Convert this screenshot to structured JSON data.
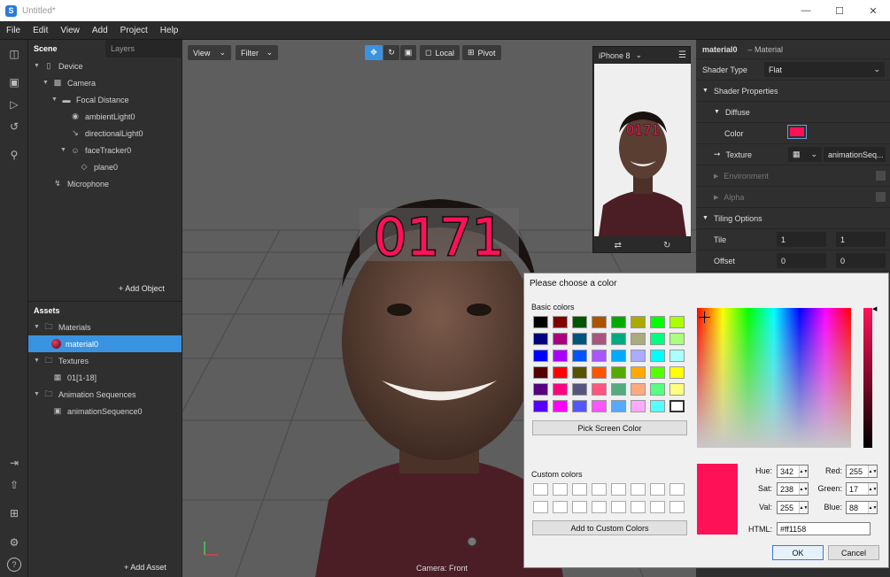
{
  "window": {
    "title": "Untitled*",
    "logo": "S"
  },
  "menu": [
    "File",
    "Edit",
    "View",
    "Add",
    "Project",
    "Help"
  ],
  "left_tools": [
    "layout-icon",
    "video-icon",
    "play-icon",
    "sync-icon",
    "search-icon",
    "import-icon",
    "share-icon",
    "folder-add-icon",
    "bug-icon",
    "help-icon"
  ],
  "scene": {
    "tabs": [
      "Scene",
      "Layers"
    ],
    "items": [
      {
        "label": "Device",
        "icon": "phone-icon"
      },
      {
        "label": "Camera",
        "icon": "camera-icon"
      },
      {
        "label": "Focal Distance",
        "icon": "ruler-icon"
      },
      {
        "label": "ambientLight0",
        "icon": "globe-icon"
      },
      {
        "label": "directionalLight0",
        "icon": "directional-light-icon"
      },
      {
        "label": "faceTracker0",
        "icon": "face-icon"
      },
      {
        "label": "plane0",
        "icon": "plane-icon"
      },
      {
        "label": "Microphone",
        "icon": "mic-icon"
      }
    ],
    "add_object": "+ Add Object"
  },
  "assets": {
    "title": "Assets",
    "items": [
      {
        "label": "Materials"
      },
      {
        "label": "material0"
      },
      {
        "label": "Textures"
      },
      {
        "label": "01[1-18]"
      },
      {
        "label": "Animation Sequences"
      },
      {
        "label": "animationSequence0"
      }
    ],
    "add_asset": "+ Add Asset"
  },
  "viewport": {
    "view": "View",
    "filter": "Filter",
    "local": "Local",
    "pivot": "Pivot",
    "overlay_text": "0171",
    "camera_label": "Camera: Front"
  },
  "phone": {
    "device": "iPhone 8",
    "overlay_text": "0171"
  },
  "inspector": {
    "name": "material0",
    "type": "– Material",
    "shader_type_label": "Shader Type",
    "shader_type_value": "Flat",
    "shader_properties": "Shader Properties",
    "diffuse": "Diffuse",
    "color_label": "Color",
    "texture_label": "Texture",
    "texture_value": "animationSeq...",
    "environment": "Environment",
    "alpha": "Alpha",
    "tiling_options": "Tiling Options",
    "tile_label": "Tile",
    "tile_x": "1",
    "tile_y": "1",
    "offset_label": "Offset",
    "offset_x": "0",
    "offset_y": "0",
    "diffuse_color": "#ff1158"
  },
  "dialog": {
    "title": "Please choose a color",
    "basic_colors_label": "Basic colors",
    "basic_colors": [
      "#000000",
      "#800000",
      "#005500",
      "#aa5500",
      "#00aa00",
      "#aaaa00",
      "#00ff00",
      "#aaff00",
      "#00007f",
      "#aa007f",
      "#00557f",
      "#aa557f",
      "#00aa7f",
      "#aaaa7f",
      "#00ff7f",
      "#aaff7f",
      "#0000ff",
      "#aa00ff",
      "#0055ff",
      "#aa55ff",
      "#00aaff",
      "#aaaaff",
      "#00ffff",
      "#aaffff",
      "#550000",
      "#ff0000",
      "#555500",
      "#ff5500",
      "#55aa00",
      "#ffaa00",
      "#55ff00",
      "#ffff00",
      "#55007f",
      "#ff007f",
      "#55557f",
      "#ff557f",
      "#55aa7f",
      "#ffaa7f",
      "#55ff7f",
      "#ffff7f",
      "#5500ff",
      "#ff00ff",
      "#5555ff",
      "#ff55ff",
      "#55aaff",
      "#ffaaff",
      "#55ffff",
      "#ffffff"
    ],
    "pick_screen": "Pick Screen Color",
    "custom_colors_label": "Custom colors",
    "add_custom": "Add to Custom Colors",
    "hue_label": "Hue:",
    "hue": "342",
    "sat_label": "Sat:",
    "sat": "238",
    "val_label": "Val:",
    "val": "255",
    "red_label": "Red:",
    "red": "255",
    "green_label": "Green:",
    "green": "17",
    "blue_label": "Blue:",
    "blue": "88",
    "html_label": "HTML:",
    "html": "#ff1158",
    "ok": "OK",
    "cancel": "Cancel",
    "selected_color": "#ff1158"
  }
}
